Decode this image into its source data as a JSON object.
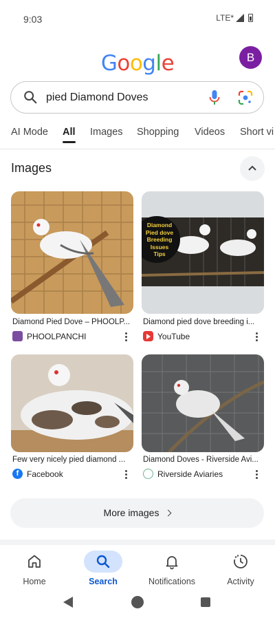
{
  "status_bar": {
    "time": "9:03",
    "network": "LTE*"
  },
  "header": {
    "logo_letters": [
      {
        "ch": "G",
        "color": "#4285F4"
      },
      {
        "ch": "o",
        "color": "#EA4335"
      },
      {
        "ch": "o",
        "color": "#FBBC05"
      },
      {
        "ch": "g",
        "color": "#4285F4"
      },
      {
        "ch": "l",
        "color": "#34A853"
      },
      {
        "ch": "e",
        "color": "#EA4335"
      }
    ],
    "avatar_letter": "B",
    "avatar_color": "#7b1fa2"
  },
  "search": {
    "query": "pied Diamond Doves"
  },
  "tabs": [
    {
      "label": "AI Mode",
      "active": false
    },
    {
      "label": "All",
      "active": true
    },
    {
      "label": "Images",
      "active": false
    },
    {
      "label": "Shopping",
      "active": false
    },
    {
      "label": "Videos",
      "active": false
    },
    {
      "label": "Short vi",
      "active": false
    }
  ],
  "images_section": {
    "title": "Images",
    "results": [
      {
        "caption": "Diamond Pied Dove – PHOOLP...",
        "source": "PHOOLPANCHI",
        "source_icon": "phoolpanchi-icon"
      },
      {
        "caption": "Diamond pied dove breeding i...",
        "source": "YouTube",
        "source_icon": "youtube-icon",
        "overlay_text": [
          "Diamond",
          "Pied dove",
          "Breeding",
          "Issues",
          "Tips"
        ]
      },
      {
        "caption": "Few very nicely pied diamond ...",
        "source": "Facebook",
        "source_icon": "facebook-icon"
      },
      {
        "caption": "Diamond Doves - Riverside Avi...",
        "source": "Riverside Aviaries",
        "source_icon": "riverside-aviaries-icon"
      }
    ],
    "more_label": "More images"
  },
  "bottom_nav": [
    {
      "label": "Home",
      "icon": "home-icon",
      "active": false
    },
    {
      "label": "Search",
      "icon": "search-icon",
      "active": true
    },
    {
      "label": "Notifications",
      "icon": "bell-icon",
      "active": false
    },
    {
      "label": "Activity",
      "icon": "activity-icon",
      "active": false
    }
  ],
  "colors": {
    "accent": "#0b57d0",
    "accent_bg": "#d3e3fd",
    "chip_bg": "#f1f3f4"
  }
}
